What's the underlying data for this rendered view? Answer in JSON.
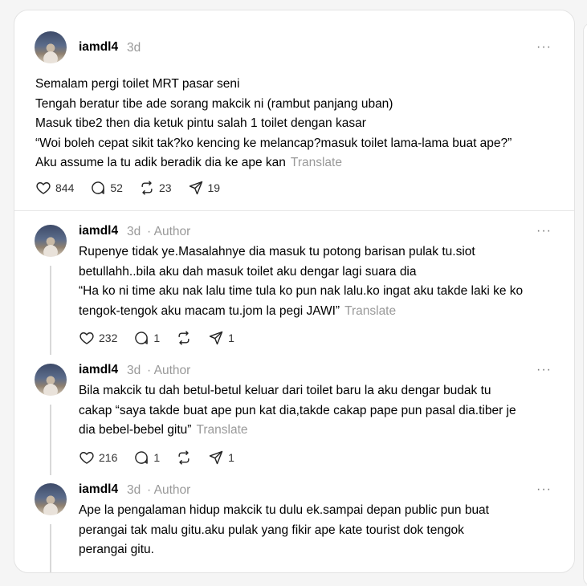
{
  "main_post": {
    "username": "iamdl4",
    "time": "3d",
    "lines": [
      "Semalam pergi toilet MRT pasar seni",
      "Tengah beratur tibe ade sorang makcik ni (rambut panjang uban)",
      "Masuk tibe2 then dia ketuk pintu salah 1 toilet dengan kasar",
      "“Woi boleh cepat sikit tak?ko kencing ke melancap?masuk toilet lama-lama buat ape?”",
      "Aku assume la tu adik beradik dia ke ape kan"
    ],
    "translate": "Translate",
    "likes": "844",
    "replies": "52",
    "reposts": "23",
    "shares": "19"
  },
  "reply1": {
    "username": "iamdl4",
    "time": "3d",
    "author": "· Author",
    "lines": [
      "Rupenye tidak ye.Masalahnye dia masuk tu potong barisan pulak tu.siot",
      "betullahh..bila aku dah masuk toilet aku dengar lagi suara dia",
      "“Ha ko ni time aku nak lalu time tula ko pun nak lalu.ko ingat aku takde laki ke ko",
      "tengok-tengok aku macam tu.jom la pegi JAWI”"
    ],
    "translate": "Translate",
    "likes": "232",
    "replies": "1",
    "shares": "1"
  },
  "reply2": {
    "username": "iamdl4",
    "time": "3d",
    "author": "· Author",
    "lines": [
      "Bila makcik tu dah betul-betul keluar dari toilet baru la aku dengar budak tu",
      "cakap “saya takde buat ape pun kat dia,takde cakap pape pun pasal dia.tiber je",
      "dia bebel-bebel gitu”"
    ],
    "translate": "Translate",
    "likes": "216",
    "replies": "1",
    "shares": "1"
  },
  "reply3": {
    "username": "iamdl4",
    "time": "3d",
    "author": "· Author",
    "lines": [
      "Ape la pengalaman hidup makcik tu dulu ek.sampai depan public pun buat",
      "perangai tak malu gitu.aku pulak yang fikir ape kate tourist dok tengok",
      "perangai gitu."
    ]
  },
  "more_icon": "···"
}
